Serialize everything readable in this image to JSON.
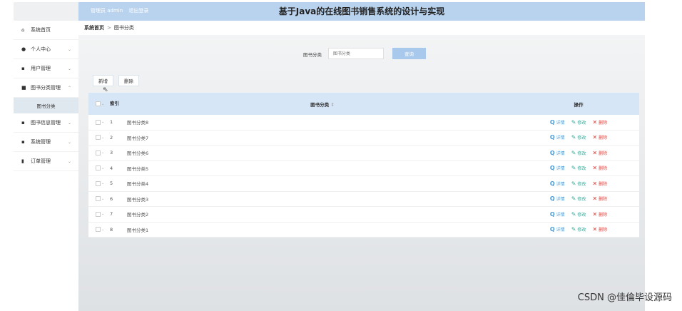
{
  "header": {
    "admin_label": "管理员 admin",
    "logout_label": "退出登录",
    "app_title": "基于Java的在线图书销售系统的设计与实现"
  },
  "sidebar": {
    "items": [
      {
        "label": "系统首页",
        "icon": "home-icon",
        "glyph": "⌂",
        "arrow": ""
      },
      {
        "label": "个人中心",
        "icon": "user-icon",
        "glyph": "●",
        "arrow": "⌄"
      },
      {
        "label": "用户管理",
        "icon": "grid-icon",
        "glyph": "▪",
        "arrow": "⌄"
      },
      {
        "label": "图书分类管理",
        "icon": "book-icon",
        "glyph": "■",
        "arrow": "⌃"
      },
      {
        "label": "图书信息管理",
        "icon": "grid-icon",
        "glyph": "▪",
        "arrow": "⌄"
      },
      {
        "label": "系统管理",
        "icon": "grid-icon",
        "glyph": "▪",
        "arrow": "⌄"
      },
      {
        "label": "订单管理",
        "icon": "lock-icon",
        "glyph": "▮",
        "arrow": "⌄"
      }
    ],
    "submenu": {
      "label": "图书分类"
    }
  },
  "breadcrumb": {
    "home": "系统首页",
    "separator": ">",
    "current": "图书分类"
  },
  "search": {
    "label": "图书分类",
    "placeholder": "图书分类",
    "button": "查询"
  },
  "actions": {
    "add": "新增",
    "delete": "删除"
  },
  "table": {
    "headers": {
      "index": "索引",
      "name": "图书分类",
      "sort": "⇕",
      "ops": "操作"
    },
    "ops": {
      "view": "详情",
      "edit": "修改",
      "delete": "删除",
      "view_glyph": "Q",
      "edit_glyph": "✎",
      "delete_glyph": "✕"
    },
    "rows": [
      {
        "index": "1",
        "name": "图书分类8"
      },
      {
        "index": "2",
        "name": "图书分类7"
      },
      {
        "index": "3",
        "name": "图书分类6"
      },
      {
        "index": "4",
        "name": "图书分类5"
      },
      {
        "index": "5",
        "name": "图书分类4"
      },
      {
        "index": "6",
        "name": "图书分类3"
      },
      {
        "index": "7",
        "name": "图书分类2"
      },
      {
        "index": "8",
        "name": "图书分类1"
      }
    ]
  },
  "watermark": "CSDN @佳倫毕设源码",
  "colors": {
    "topbar": "#b9d3ee",
    "table_header": "#d6e6f6",
    "search_button": "#a9c9ec",
    "view": "#4a9ad6",
    "edit": "#3aa99a",
    "delete": "#e0403a"
  }
}
